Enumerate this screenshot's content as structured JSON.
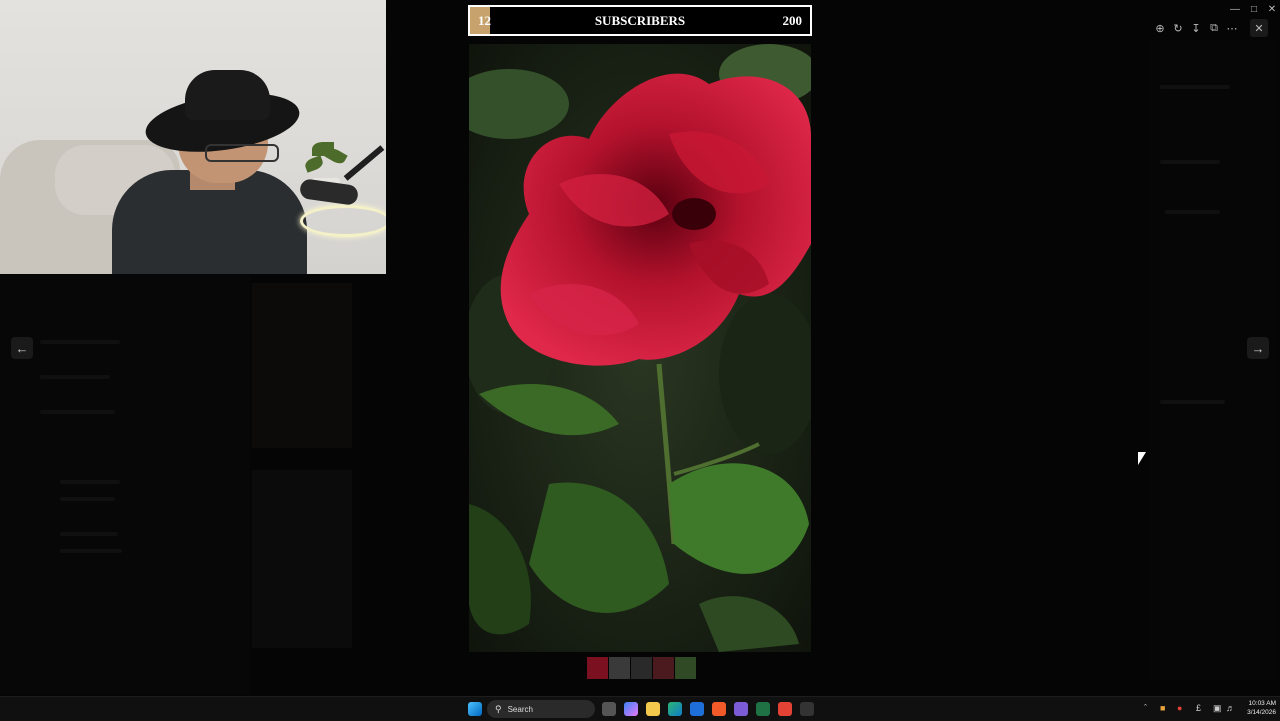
{
  "subscriber_goal": {
    "current": "12",
    "title": "SUBSCRIBERS",
    "goal": "200",
    "progress_fraction": 0.06,
    "fill_color": "#c7a26c"
  },
  "viewer": {
    "prev_icon": "arrow-left-icon",
    "next_icon": "arrow-right-icon",
    "toolbar_icons": [
      "zoom-in-icon",
      "rotate-icon",
      "download-icon",
      "open-external-icon",
      "more-icon"
    ],
    "close_icon": "close-icon",
    "thumbnail_count": 5
  },
  "taskbar": {
    "search_placeholder": "Search",
    "time": "10:03 AM",
    "date": "3/14/2026"
  },
  "colors": {
    "flower": "#c0142e",
    "leaf": "#3f7a2a",
    "accent": "#c7a26c"
  }
}
